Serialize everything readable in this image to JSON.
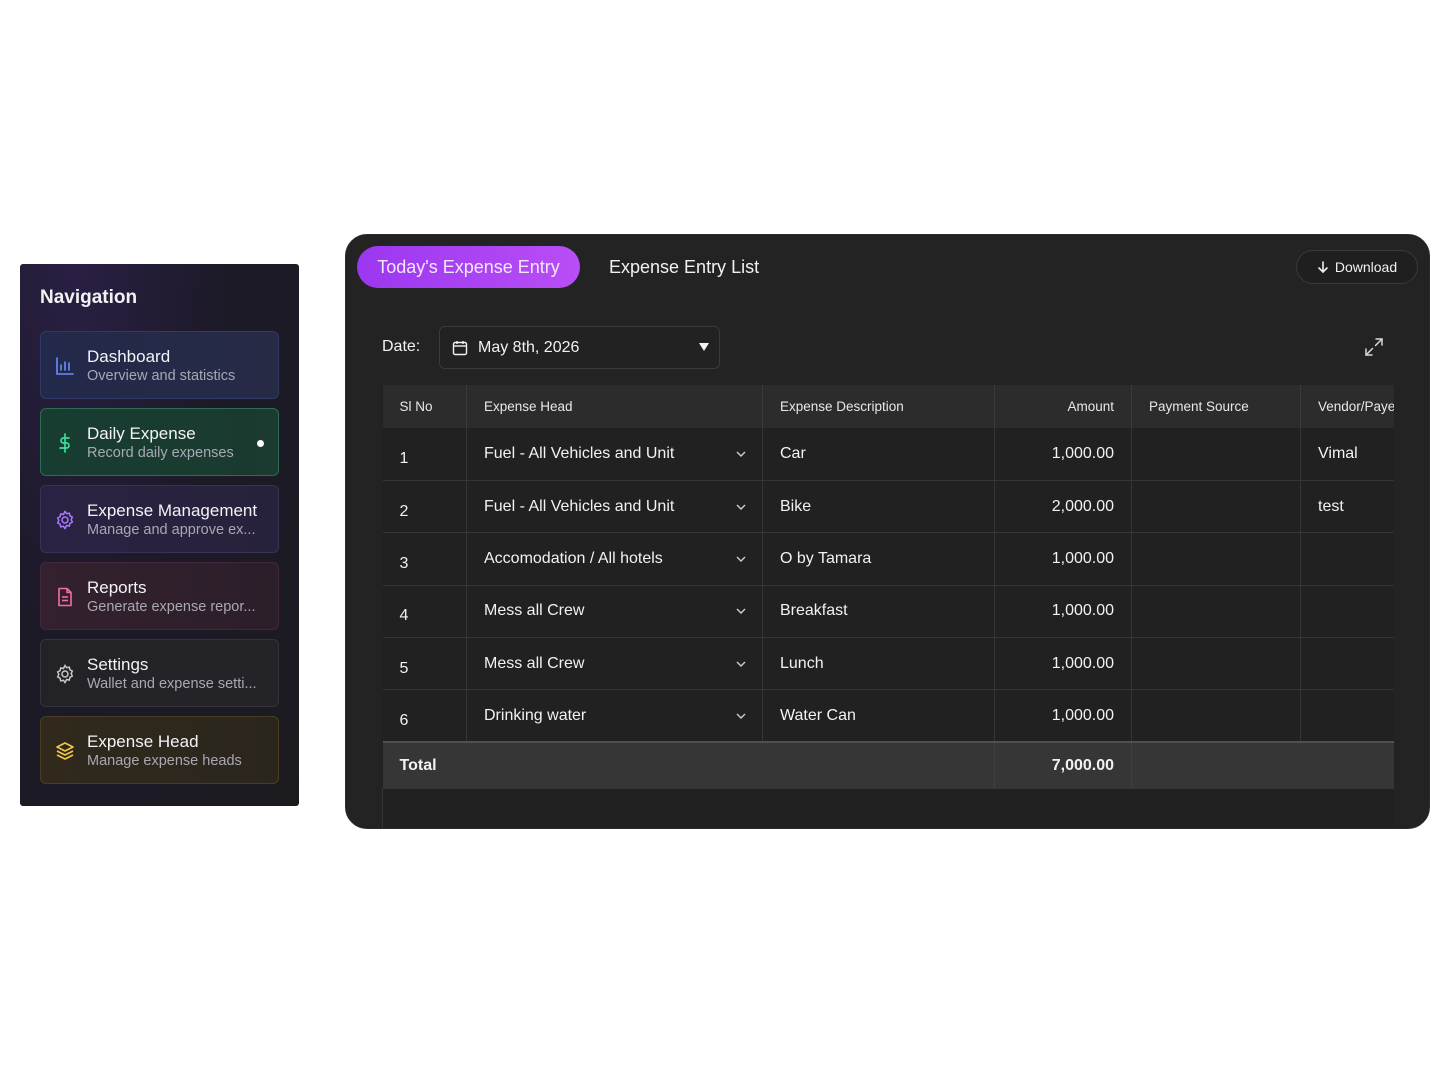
{
  "nav": {
    "title": "Navigation",
    "items": [
      {
        "label": "Dashboard",
        "sub": "Overview and statistics",
        "icon": "bar-chart-icon",
        "color": "#6b8cff"
      },
      {
        "label": "Daily Expense",
        "sub": "Record daily expenses",
        "icon": "dollar-icon",
        "color": "#3ddc97",
        "active": true
      },
      {
        "label": "Expense Management",
        "sub": "Manage and approve ex...",
        "icon": "gear-icon",
        "color": "#a77bff"
      },
      {
        "label": "Reports",
        "sub": "Generate expense repor...",
        "icon": "document-icon",
        "color": "#f06fa3"
      },
      {
        "label": "Settings",
        "sub": "Wallet and expense setti...",
        "icon": "gear-icon",
        "color": "#c8c8cc"
      },
      {
        "label": "Expense Head",
        "sub": "Manage expense heads",
        "icon": "layers-icon",
        "color": "#f2c84b"
      }
    ]
  },
  "tabs": {
    "active": "Today's Expense Entry",
    "inactive": "Expense Entry List"
  },
  "toolbar": {
    "download_label": "Download"
  },
  "date": {
    "label": "Date:",
    "value": "May 8th, 2026"
  },
  "table": {
    "headers": [
      "Sl No",
      "Expense Head",
      "Expense Description",
      "Amount",
      "Payment Source",
      "Vendor/Payee"
    ],
    "rows": [
      {
        "sl": "1",
        "head": "Fuel - All Vehicles and Unit",
        "desc": "Car",
        "amount": "1,000.00",
        "source": "",
        "vendor": "Vimal"
      },
      {
        "sl": "2",
        "head": "Fuel - All Vehicles and Unit",
        "desc": "Bike",
        "amount": "2,000.00",
        "source": "",
        "vendor": "test"
      },
      {
        "sl": "3",
        "head": "Accomodation / All hotels",
        "desc": "O by Tamara",
        "amount": "1,000.00",
        "source": "",
        "vendor": ""
      },
      {
        "sl": "4",
        "head": "Mess all Crew",
        "desc": "Breakfast",
        "amount": "1,000.00",
        "source": "",
        "vendor": ""
      },
      {
        "sl": "5",
        "head": "Mess all Crew",
        "desc": "Lunch",
        "amount": "1,000.00",
        "source": "",
        "vendor": ""
      },
      {
        "sl": "6",
        "head": "Drinking water",
        "desc": "Water Can",
        "amount": "1,000.00",
        "source": "",
        "vendor": ""
      }
    ],
    "total_label": "Total",
    "total_amount": "7,000.00"
  }
}
